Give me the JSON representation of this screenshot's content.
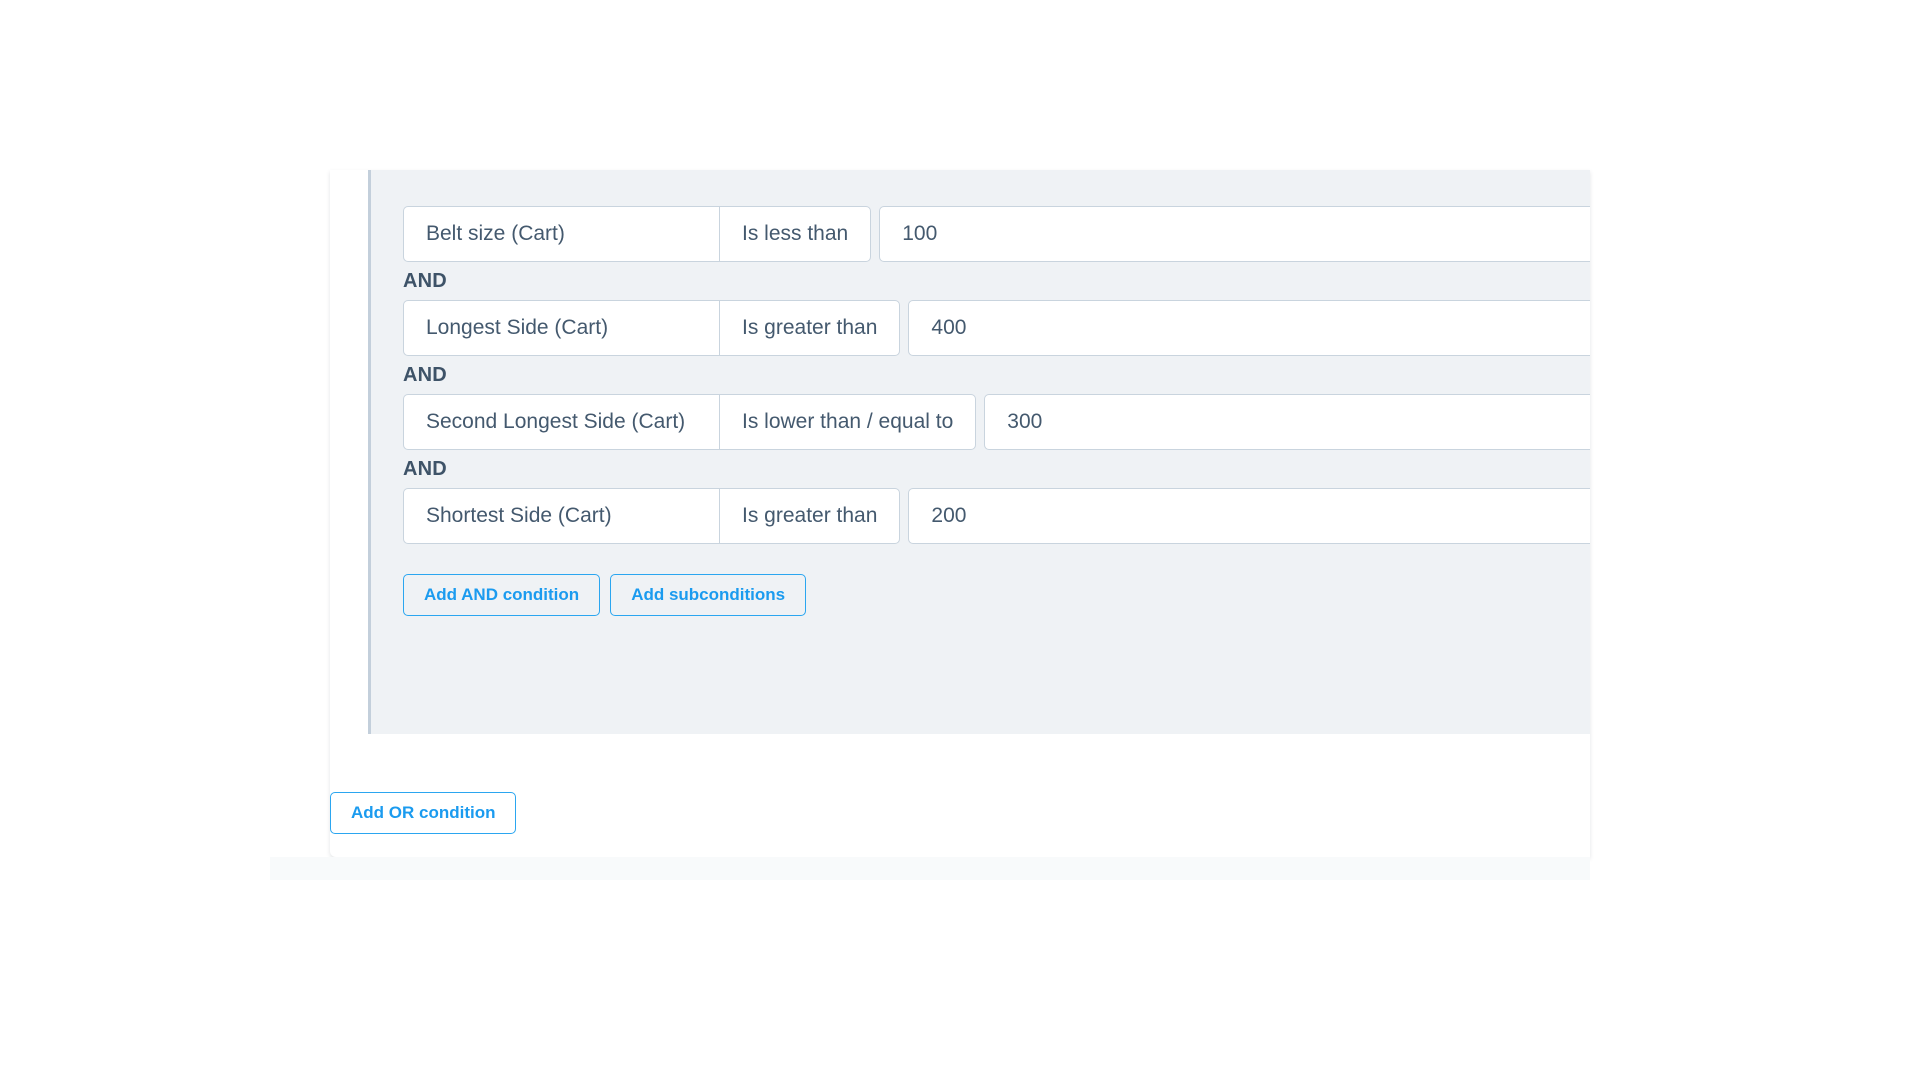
{
  "rule_builder": {
    "conjunction_label": "AND",
    "conditions": [
      {
        "field": "Belt size (Cart)",
        "operator": "Is less than",
        "value": "100"
      },
      {
        "field": "Longest Side (Cart)",
        "operator": "Is greater than",
        "value": "400"
      },
      {
        "field": "Second Longest Side (Cart)",
        "operator": "Is lower than / equal to",
        "value": "300"
      },
      {
        "field": "Shortest Side (Cart)",
        "operator": "Is greater than",
        "value": "200"
      }
    ],
    "buttons": {
      "add_and": "Add AND condition",
      "add_subconditions": "Add subconditions",
      "add_or": "Add OR condition"
    }
  },
  "colors": {
    "accent": "#1b9bef",
    "panel_bg": "#eff2f5",
    "panel_border": "#c3cfdb",
    "input_border": "#c9d4de",
    "text": "#44596e",
    "label_text": "#3e5368",
    "page_bg": "#ffffff",
    "footer_bg": "#f8fafb"
  }
}
